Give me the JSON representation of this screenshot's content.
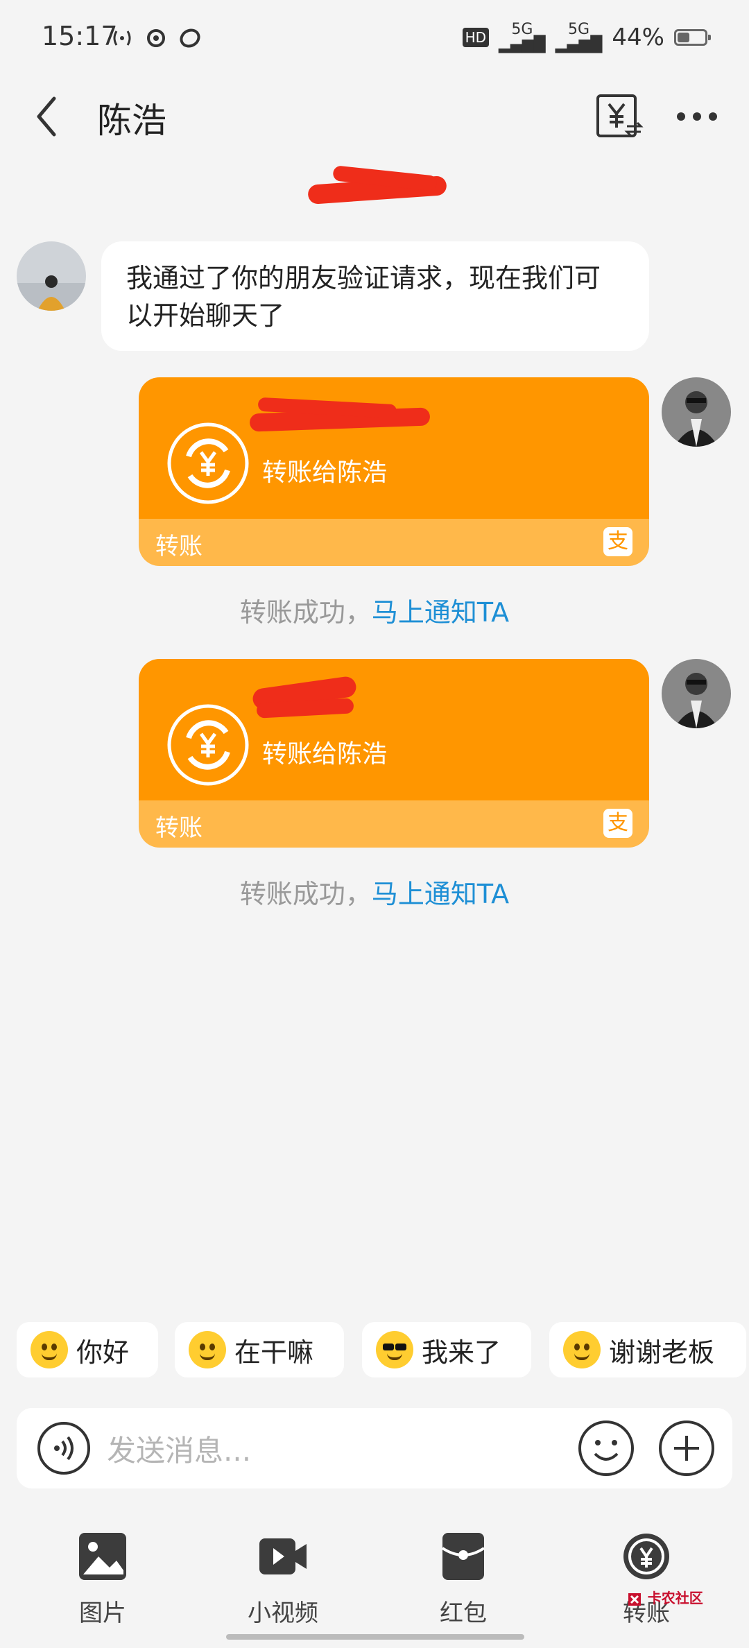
{
  "status_bar": {
    "time": "15:17",
    "hd_label": "HD",
    "signal1": "5G",
    "signal2": "5G",
    "battery_text": "44%",
    "battery_level": 0.44
  },
  "header": {
    "title": "陈浩",
    "back_icon": "chevron-left-icon",
    "bill_icon": "bill-yuan-icon",
    "more_icon": "more-dots-icon"
  },
  "messages": {
    "incoming": {
      "text": "我通过了你的朋友验证请求，现在我们可以开始聊天了"
    },
    "transfers": [
      {
        "description": "转账给陈浩",
        "label": "转账",
        "notice_text": "转账成功，",
        "notice_link": "马上通知TA"
      },
      {
        "description": "转账给陈浩",
        "label": "转账",
        "notice_text": "转账成功，",
        "notice_link": "马上通知TA"
      }
    ]
  },
  "quick_replies": [
    {
      "label": "你好"
    },
    {
      "label": "在干嘛"
    },
    {
      "label": "我来了"
    },
    {
      "label": "谢谢老板"
    }
  ],
  "input": {
    "placeholder": "发送消息..."
  },
  "toolbar": {
    "items": [
      {
        "label": "图片",
        "icon": "image-icon"
      },
      {
        "label": "小视频",
        "icon": "video-icon"
      },
      {
        "label": "红包",
        "icon": "red-packet-icon"
      },
      {
        "label": "转账",
        "icon": "transfer-icon"
      }
    ]
  },
  "watermark": {
    "text": "卡农社区"
  },
  "colors": {
    "transfer_card": "#ff9600",
    "transfer_card_footer": "#ffb84a",
    "link": "#1e8fd5",
    "background": "#f4f4f4"
  }
}
